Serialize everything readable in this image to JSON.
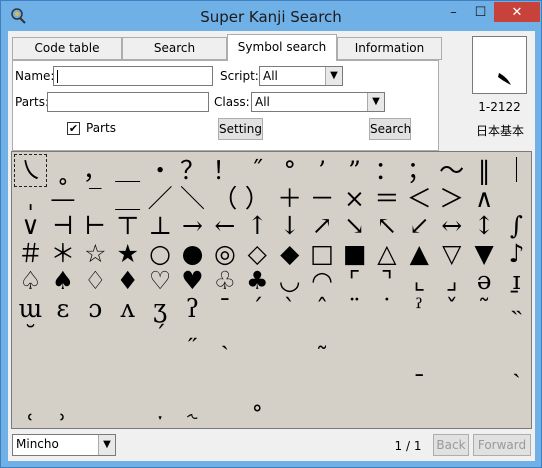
{
  "window": {
    "title": "Super Kanji Search",
    "controls": {
      "minimize": "–",
      "maximize": "☐",
      "close": "✕"
    },
    "icon": "app-icon"
  },
  "tabs": [
    {
      "label": "Code table",
      "active": false
    },
    {
      "label": "Search",
      "active": false
    },
    {
      "label": "Symbol search",
      "active": true
    },
    {
      "label": "Information",
      "active": false
    }
  ],
  "search_form": {
    "name_label": "Name:",
    "name_value": "",
    "script_label": "Script:",
    "script_value": "All",
    "parts_label": "Parts:",
    "parts_value": "",
    "class_label": "Class:",
    "class_value": "All",
    "parts_checkbox_label": "Parts",
    "parts_checked": true,
    "setting_button": "Setting",
    "search_button": "Search"
  },
  "preview": {
    "glyph": "㇏",
    "code": "1-2122",
    "font_name": "日本基本"
  },
  "symbols": [
    "㇏",
    "˳",
    "，",
    "＿",
    "・",
    "？",
    "！",
    "˝",
    "°",
    "’",
    "”",
    "：",
    "；",
    "～",
    "‖",
    "｜",
    "ˌ",
    "—",
    "‾",
    "＿",
    "／",
    "＼",
    "（",
    "）",
    "＋",
    "－",
    "×",
    "＝",
    "＜",
    "＞",
    "∧",
    "",
    "∨",
    "⊣",
    "⊢",
    "⊤",
    "⊥",
    "→",
    "←",
    "↑",
    "↓",
    "↗",
    "↘",
    "↖",
    "↙",
    "↔",
    "↕",
    "∫",
    "＃",
    "＊",
    "☆",
    "★",
    "○",
    "●",
    "◎",
    "◇",
    "◆",
    "□",
    "■",
    "△",
    "▲",
    "▽",
    "▼",
    "♪",
    "♤",
    "♠",
    "♢",
    "♦",
    "♡",
    "♥",
    "♧",
    "♣",
    "◡",
    "◠",
    "⌜",
    "⌝",
    "⌞",
    "⌟",
    "ə",
    "ɪ̱",
    "ɯ",
    "ɛ",
    "ɔ",
    "ʌ",
    "ʒ",
    "ʔ",
    "ˉ",
    "ˊ",
    "ˋ",
    "ˆ",
    "¨",
    "˙",
    "ˀ",
    "ˇ",
    "˜",
    "˵",
    "˘",
    "",
    "",
    "",
    "ˊ",
    "˶",
    "ˏ",
    "",
    "",
    "˷",
    "",
    "",
    "",
    "",
    "",
    "",
    "",
    "",
    "",
    "",
    "",
    "",
    "",
    "",
    "",
    "",
    "",
    "",
    "ˍ",
    "",
    "",
    "ˎ",
    "",
    "",
    "",
    "",
    "",
    "",
    "",
    "",
    "",
    "",
    "",
    "",
    "",
    "",
    "",
    "",
    "˓",
    "˒",
    "",
    "",
    "ˑ",
    "˞",
    "ˍ",
    "˚",
    "",
    "",
    "",
    "",
    "",
    "",
    "",
    ""
  ],
  "bottom": {
    "font_value": "Mincho",
    "page": "1 / 1",
    "back_button": "Back",
    "forward_button": "Forward"
  },
  "colors": {
    "titlebar": "#6fb0e6",
    "close_button": "#c7423a",
    "grid_background": "#d4d0c8"
  }
}
